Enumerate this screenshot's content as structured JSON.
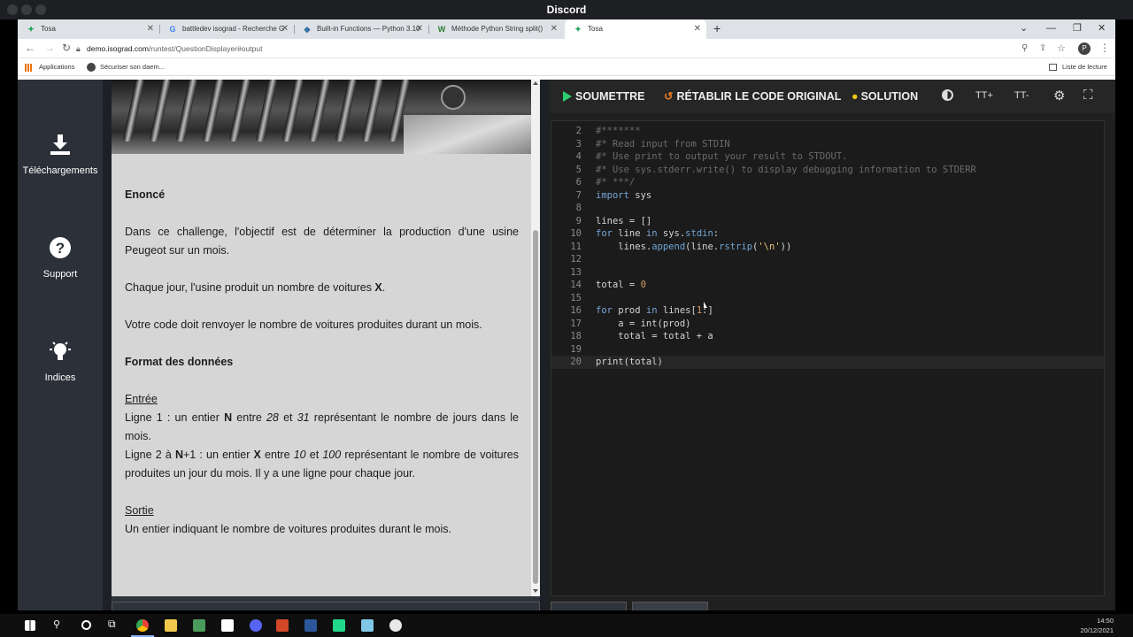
{
  "discord": {
    "title": "Discord"
  },
  "browser": {
    "tabs": [
      {
        "icon": "tosa-icon",
        "label": "Tosa"
      },
      {
        "icon": "google-icon",
        "label": "battledev isograd - Recherche G"
      },
      {
        "icon": "python-icon",
        "label": "Built-in Functions — Python 3.10"
      },
      {
        "icon": "w3-icon",
        "label": "Méthode Python String split()"
      },
      {
        "icon": "tosa-icon",
        "label": "Tosa"
      }
    ],
    "new_tab": "+",
    "url_host": "demo.isograd.com",
    "url_path": "/runtest/QuestionDisplayer#output",
    "bookmarks": [
      "Applications",
      "Sécuriser son daem..."
    ],
    "reading_list": "Liste de lecture",
    "profile_letter": "P"
  },
  "sidebar": {
    "items": [
      {
        "icon": "download-icon",
        "label": "Téléchargements"
      },
      {
        "icon": "help-icon",
        "label": "Support"
      },
      {
        "icon": "lightbulb-icon",
        "label": "Indices"
      }
    ]
  },
  "question": {
    "heading": "Enoncé",
    "p1": "Dans ce challenge, l'objectif est de déterminer la production d'une usine Peugeot sur un mois.",
    "p2_a": "Chaque jour, l'usine produit un nombre de voitures ",
    "p2_b": "X",
    "p2_c": ".",
    "p3": "Votre code doit renvoyer le nombre de voitures produites durant un mois.",
    "format_heading": "Format des données",
    "input_heading": "Entrée",
    "l1_a": "Ligne 1 : un entier ",
    "l1_b": "N",
    "l1_c": " entre ",
    "l1_d": "28",
    "l1_e": " et ",
    "l1_f": "31",
    "l1_g": " représentant le nombre de jours dans le mois.",
    "l2_a": "Ligne 2 à ",
    "l2_b": "N",
    "l2_c": "+1 : un entier ",
    "l2_d": "X",
    "l2_e": " entre ",
    "l2_f": "10",
    "l2_g": " et ",
    "l2_h": "100",
    "l2_i": " représentant le nombre de voitures produites un jour du mois. Il y a une ligne pour chaque jour.",
    "output_heading": "Sortie",
    "output_text": "Un entier indiquant le nombre de voitures produites durant le mois."
  },
  "toolbar": {
    "submit": "SOUMETTRE",
    "reset": "RÉTABLIR LE CODE ORIGINAL",
    "solution": "SOLUTION",
    "font_up": "TT+",
    "font_down": "TT-"
  },
  "code": {
    "lines": [
      {
        "n": "2",
        "text": "#*******"
      },
      {
        "n": "3",
        "text": "#* Read input from STDIN"
      },
      {
        "n": "4",
        "text": "#* Use print to output your result to STDOUT."
      },
      {
        "n": "5",
        "text": "#* Use sys.stderr.write() to display debugging information to STDERR"
      },
      {
        "n": "6",
        "text": "#* ***/"
      },
      {
        "n": "7",
        "text": "import sys"
      },
      {
        "n": "8",
        "text": ""
      },
      {
        "n": "9",
        "text": "lines = []"
      },
      {
        "n": "10",
        "text": "for line in sys.stdin:"
      },
      {
        "n": "11",
        "text": "    lines.append(line.rstrip('\\n'))"
      },
      {
        "n": "12",
        "text": ""
      },
      {
        "n": "13",
        "text": ""
      },
      {
        "n": "14",
        "text": "total = 0"
      },
      {
        "n": "15",
        "text": ""
      },
      {
        "n": "16",
        "text": "for prod in lines[1:]"
      },
      {
        "n": "17",
        "text": "    a = int(prod)"
      },
      {
        "n": "18",
        "text": "    total = total + a"
      },
      {
        "n": "19",
        "text": ""
      },
      {
        "n": "20",
        "text": "print(total)"
      }
    ],
    "current_line": "20"
  },
  "taskbar": {
    "time": "14:50",
    "date": "20/12/2021"
  }
}
